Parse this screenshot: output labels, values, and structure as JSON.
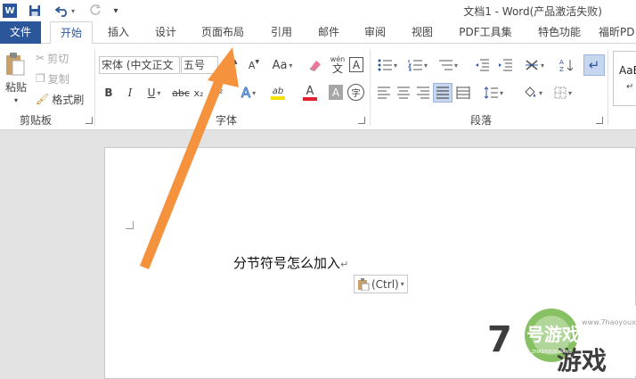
{
  "titlebar": {
    "app_badge": "W",
    "document_title": "文档1 - Word(产品激活失败)",
    "quick_access": {
      "save": "save-icon",
      "undo": "undo-icon",
      "redo": "redo-icon"
    }
  },
  "tabs": [
    "文件",
    "开始",
    "插入",
    "设计",
    "页面布局",
    "引用",
    "邮件",
    "审阅",
    "视图",
    "PDF工具集",
    "特色功能",
    "福昕PD"
  ],
  "ribbon": {
    "clipboard": {
      "paste": "粘贴",
      "cut": "剪切",
      "copy": "复制",
      "format_painter": "格式刷",
      "label": "剪贴板"
    },
    "font": {
      "font_name": "宋体 (中文正文",
      "font_size": "五号",
      "grow": "A",
      "shrink": "A",
      "change_case": "Aa",
      "phonetic": "wén",
      "phonetic_char": "文",
      "char_border": "A",
      "bold": "B",
      "italic": "I",
      "underline": "U",
      "strike": "abc",
      "subscript": "x₂",
      "superscript": "x²",
      "text_effect": "A",
      "highlight": "ab",
      "font_color": "A",
      "char_shading": "A",
      "enclose": "字",
      "label": "字体"
    },
    "paragraph": {
      "label": "段落"
    },
    "styles": {
      "preview": "AaBl",
      "mark": "↵"
    }
  },
  "document": {
    "text": "分节符号怎么加入",
    "para_mark": "↵",
    "paste_options": "(Ctrl)"
  },
  "watermark": {
    "brand": "7号游戏网",
    "sub": "ZHAOYOUXIWANG",
    "url": "www.7haoyouxi.com"
  },
  "colors": {
    "accent": "#2b579a",
    "arrow": "#f5923e",
    "highlight": "#f4e100",
    "font_red": "#e0202a"
  }
}
